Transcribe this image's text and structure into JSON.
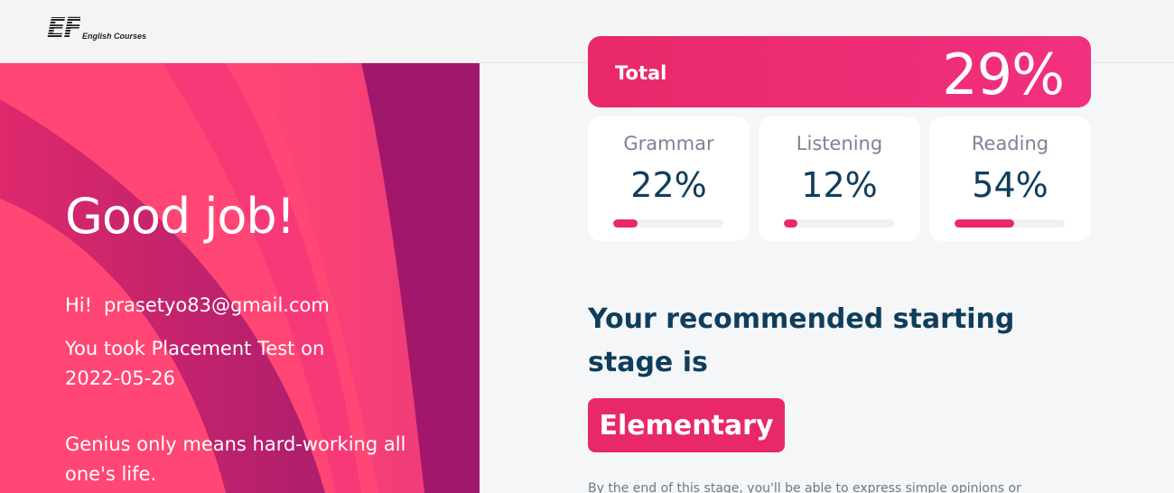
{
  "header": {
    "logo_mark": "EF",
    "logo_text": "English Courses"
  },
  "hero": {
    "title": "Good job!",
    "greeting_prefix": "Hi!",
    "email": "prasetyo83@gmail.com",
    "took_test_text": "You took Placement Test on",
    "test_date": "2022-05-26",
    "quote": "Genius only means hard-working all one's life."
  },
  "results": {
    "total_label": "Total",
    "total_value": "29%",
    "skills": [
      {
        "name": "Grammar",
        "value": "22%",
        "percent": 22
      },
      {
        "name": "Listening",
        "value": "12%",
        "percent": 12
      },
      {
        "name": "Reading",
        "value": "54%",
        "percent": 54
      }
    ]
  },
  "recommendation": {
    "heading": "Your recommended starting stage is",
    "stage": "Elementary",
    "description": "By the end of this stage, you'll be able to express simple opinions or"
  },
  "colors": {
    "accent": "#e8286a",
    "hero_bg": "#ff4675",
    "dark_text": "#0f3d5c"
  }
}
